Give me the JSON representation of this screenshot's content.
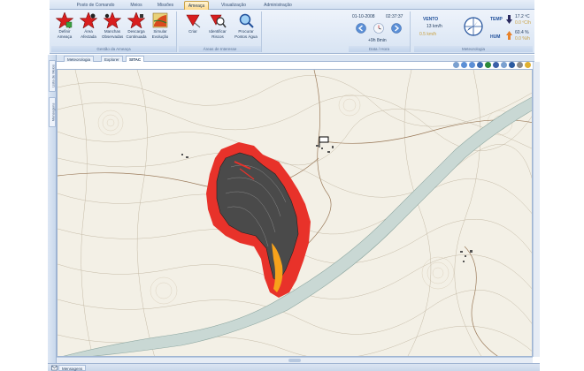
{
  "ribbon_tabs": [
    "Posto de Comando",
    "Meios",
    "Missões",
    "Ameaça",
    "Visualização",
    "Administração"
  ],
  "active_ribbon_tab": "Ameaça",
  "groups": {
    "gestao": {
      "title": "Gestão da Ameaça",
      "buttons": [
        {
          "label1": "Definir",
          "label2": "Ameaça"
        },
        {
          "label1": "Área",
          "label2": "Afectada"
        },
        {
          "label1": "Manchas",
          "label2": "Observadas"
        },
        {
          "label1": "Descarga",
          "label2": "Continuada"
        },
        {
          "label1": "Simular",
          "label2": "Evolução"
        }
      ]
    },
    "areas": {
      "title": "Áreas de Interesse",
      "buttons": [
        {
          "label1": "Criar",
          "label2": ""
        },
        {
          "label1": "Identificar",
          "label2": "Riscos"
        },
        {
          "label1": "Procurar",
          "label2": "Pontos Água"
        }
      ]
    },
    "data_hora": {
      "title": "Data / Hora",
      "date": "01-10-2008",
      "time": "02:37:37",
      "offset": "+9h 8min"
    },
    "meteo": {
      "title": "Meteorologia",
      "wind_label": "VENTO",
      "wind_speed": "13 km/h",
      "wind_speed_sub": "0.5 km/h",
      "temp_label": "TEMP",
      "temp_value": "17.2 ºC",
      "temp_sub": "0.0 ºC/h",
      "hum_label": "HUM",
      "hum_value": "60.4 %",
      "hum_sub": "0.0 %/h"
    }
  },
  "left_panel_tabs": [
    "Lista de Meios",
    "Mensagens"
  ],
  "document_tabs": [
    "Meteorologia",
    "Explorer",
    "SITAC"
  ],
  "active_document_tab": "SITAC",
  "status_tab": "Mensagens",
  "colors": {
    "fire_outer": "#e8322a",
    "fire_burned": "#4a4a4a",
    "fire_front": "#f7a21b",
    "river": "#c9d8d4",
    "map_bg": "#f3f0e6",
    "accent": "#ffd98a"
  }
}
